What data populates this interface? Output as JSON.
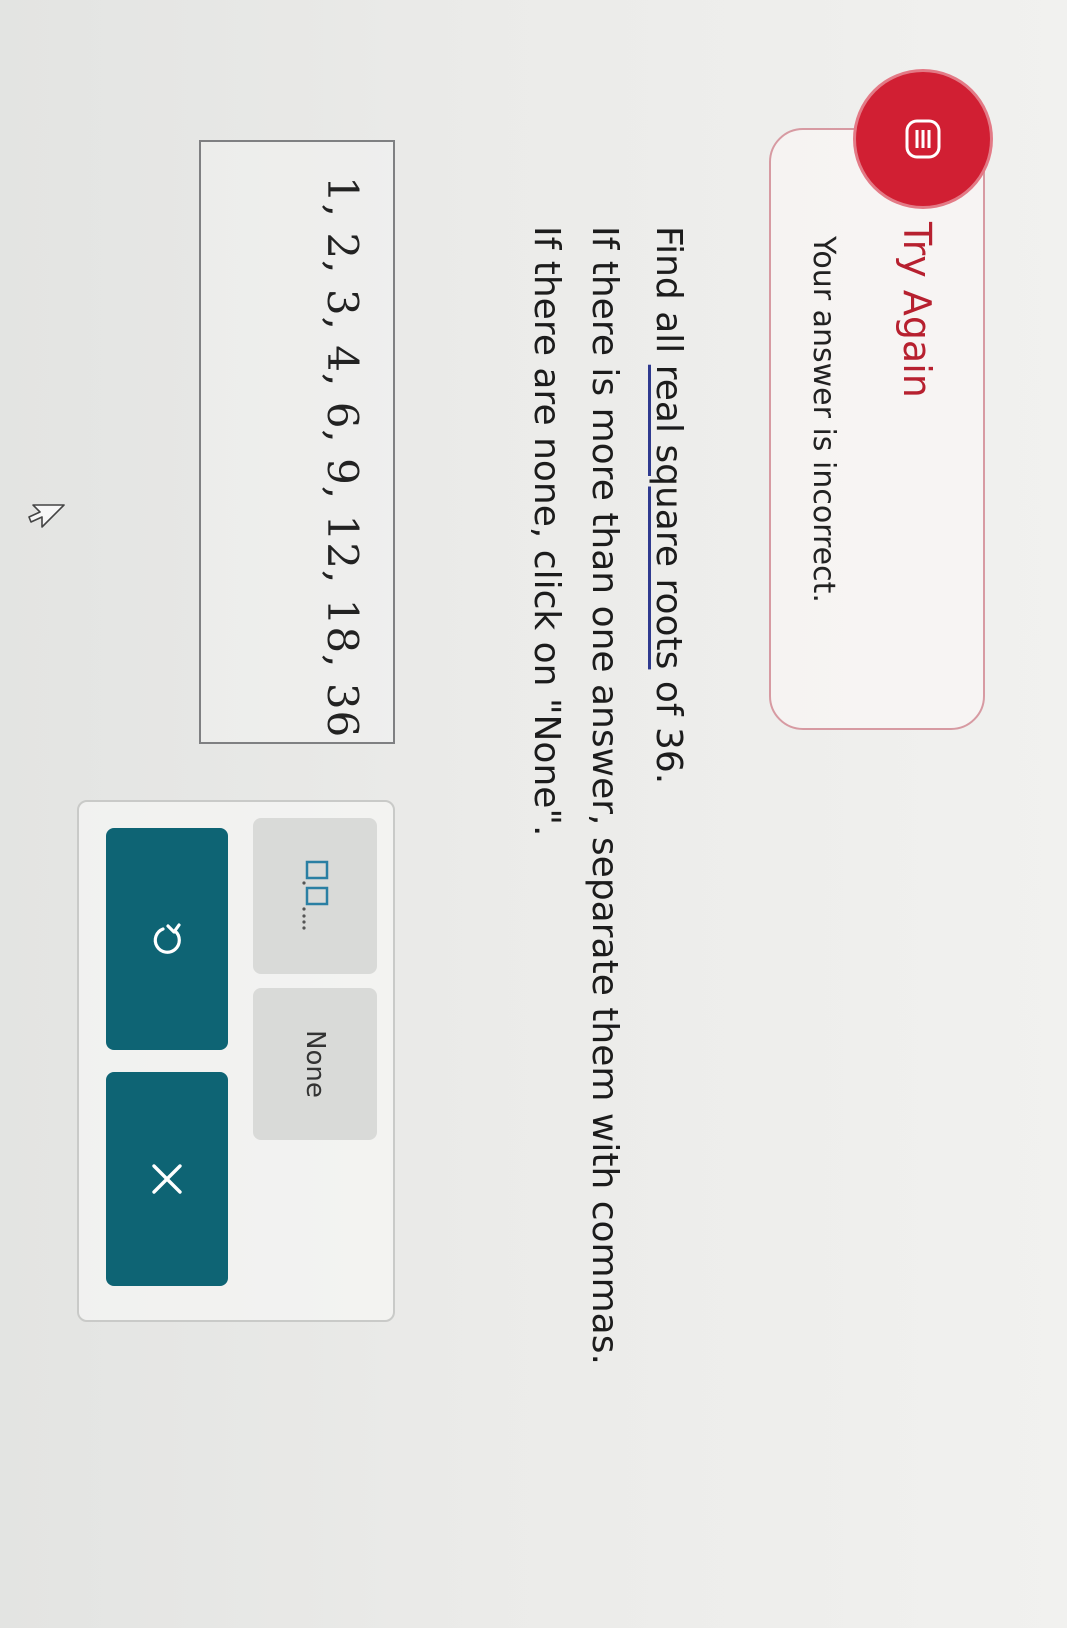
{
  "feedback": {
    "title": "Try Again",
    "message": "Your answer is incorrect.",
    "accent_color": "#d11f33",
    "icon": "alert-lines-icon"
  },
  "question": {
    "prefix": "Find all ",
    "link_text": "real square roots",
    "suffix": " of 36.",
    "instruction_line1": "If there is more than one answer, separate them with commas.",
    "instruction_line2": "If there are none, click on \"None\"."
  },
  "answer": {
    "value": "1, 2, 3, 4, 6, 9, 12, 18, 36"
  },
  "toolbox": {
    "list_tool_label": "□,□,...",
    "list_tool_icon": "comma-list-icon",
    "none_label": "None",
    "undo_icon": "undo-icon",
    "clear_icon": "close-icon",
    "button_color": "#0e6474"
  }
}
